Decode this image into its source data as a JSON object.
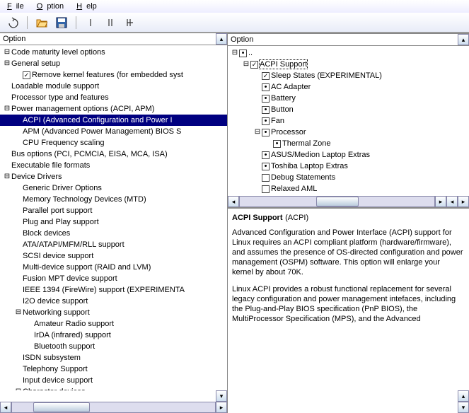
{
  "menu": {
    "file": "File",
    "option": "Option",
    "help": "Help"
  },
  "header_label": "Option",
  "left_tree": [
    {
      "indent": 0,
      "tw": "-",
      "label": "Code maturity level options"
    },
    {
      "indent": 0,
      "tw": "-",
      "label": "General setup"
    },
    {
      "indent": 1,
      "tw": "",
      "box": "check",
      "label": "Remove kernel features (for embedded syst"
    },
    {
      "indent": 0,
      "tw": "",
      "label": "Loadable module support"
    },
    {
      "indent": 0,
      "tw": "",
      "label": "Processor type and features"
    },
    {
      "indent": 0,
      "tw": "-",
      "label": "Power management options (ACPI, APM)"
    },
    {
      "indent": 1,
      "tw": "",
      "label": "ACPI (Advanced Configuration and Power I",
      "sel": true
    },
    {
      "indent": 1,
      "tw": "",
      "label": "APM (Advanced Power Management) BIOS S"
    },
    {
      "indent": 1,
      "tw": "",
      "label": "CPU Frequency scaling"
    },
    {
      "indent": 0,
      "tw": "",
      "label": "Bus options (PCI, PCMCIA, EISA, MCA, ISA)"
    },
    {
      "indent": 0,
      "tw": "",
      "label": "Executable file formats"
    },
    {
      "indent": 0,
      "tw": "-",
      "label": "Device Drivers"
    },
    {
      "indent": 1,
      "tw": "",
      "label": "Generic Driver Options"
    },
    {
      "indent": 1,
      "tw": "",
      "label": "Memory Technology Devices (MTD)"
    },
    {
      "indent": 1,
      "tw": "",
      "label": "Parallel port support"
    },
    {
      "indent": 1,
      "tw": "",
      "label": "Plug and Play support"
    },
    {
      "indent": 1,
      "tw": "",
      "label": "Block devices"
    },
    {
      "indent": 1,
      "tw": "",
      "label": "ATA/ATAPI/MFM/RLL support"
    },
    {
      "indent": 1,
      "tw": "",
      "label": "SCSI device support"
    },
    {
      "indent": 1,
      "tw": "",
      "label": "Multi-device support (RAID and LVM)"
    },
    {
      "indent": 1,
      "tw": "",
      "label": "Fusion MPT device support"
    },
    {
      "indent": 1,
      "tw": "",
      "label": "IEEE 1394 (FireWire) support (EXPERIMENTA"
    },
    {
      "indent": 1,
      "tw": "",
      "label": "I2O device support"
    },
    {
      "indent": 1,
      "tw": "-",
      "label": "Networking support"
    },
    {
      "indent": 2,
      "tw": "",
      "label": "Amateur Radio support"
    },
    {
      "indent": 2,
      "tw": "",
      "label": "IrDA (infrared) support"
    },
    {
      "indent": 2,
      "tw": "",
      "label": "Bluetooth support"
    },
    {
      "indent": 1,
      "tw": "",
      "label": "ISDN subsystem"
    },
    {
      "indent": 1,
      "tw": "",
      "label": "Telephony Support"
    },
    {
      "indent": 1,
      "tw": "",
      "label": "Input device support"
    },
    {
      "indent": 1,
      "tw": "-",
      "label": "Character devices"
    }
  ],
  "right_tree": [
    {
      "indent": 0,
      "tw": "-",
      "box": "dot",
      "label": ".."
    },
    {
      "indent": 1,
      "tw": "-",
      "box": "check",
      "label": "ACPI Support",
      "hl": true
    },
    {
      "indent": 2,
      "tw": "",
      "box": "check",
      "label": "Sleep States (EXPERIMENTAL)"
    },
    {
      "indent": 2,
      "tw": "",
      "box": "dot",
      "label": "AC Adapter"
    },
    {
      "indent": 2,
      "tw": "",
      "box": "dot",
      "label": "Battery"
    },
    {
      "indent": 2,
      "tw": "",
      "box": "dot",
      "label": "Button"
    },
    {
      "indent": 2,
      "tw": "",
      "box": "dot",
      "label": "Fan"
    },
    {
      "indent": 2,
      "tw": "-",
      "box": "dot",
      "label": "Processor"
    },
    {
      "indent": 3,
      "tw": "",
      "box": "dot",
      "label": "Thermal Zone"
    },
    {
      "indent": 2,
      "tw": "",
      "box": "dot",
      "label": "ASUS/Medion Laptop Extras"
    },
    {
      "indent": 2,
      "tw": "",
      "box": "dot",
      "label": "Toshiba Laptop Extras"
    },
    {
      "indent": 2,
      "tw": "",
      "box": "empty",
      "label": "Debug Statements"
    },
    {
      "indent": 2,
      "tw": "",
      "box": "empty",
      "label": "Relaxed AML"
    }
  ],
  "info": {
    "title": "ACPI Support",
    "paren": "(ACPI)",
    "p1": "Advanced Configuration and Power Interface (ACPI) support for\nLinux requires an ACPI compliant platform (hardware/firmware),\nand assumes the presence of OS-directed configuration and power\nmanagement (OSPM) software. This option will enlarge your\nkernel by about 70K.",
    "p2": "Linux ACPI provides a robust functional replacement for several\nlegacy configuration and power management intefaces, including\nthe Plug-and-Play BIOS specification (PnP BIOS), the\nMultiProcessor Specification (MPS), and the Advanced"
  }
}
